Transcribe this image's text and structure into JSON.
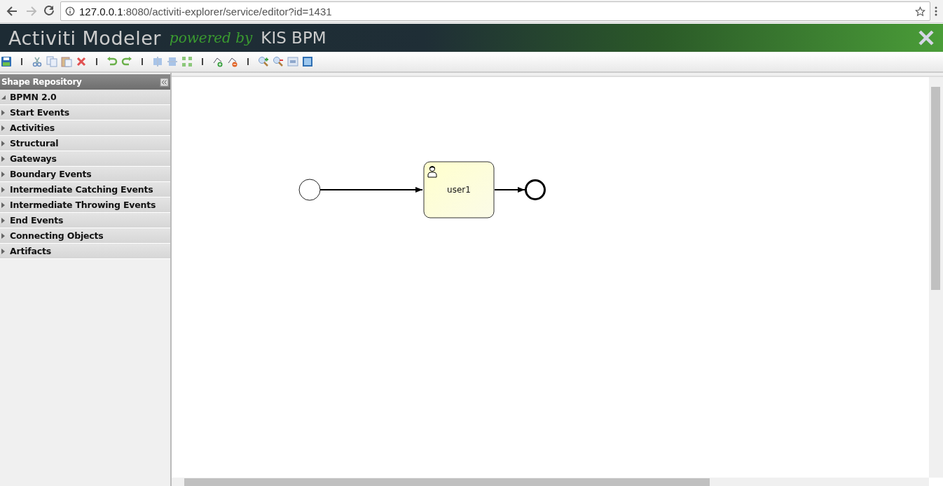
{
  "browser": {
    "url_host": "127.0.0.1",
    "url_rest": ":8080/activiti-explorer/service/editor?id=1431"
  },
  "header": {
    "title": "Activiti Modeler",
    "tagline": "powered by",
    "brand": "KIS BPM"
  },
  "sidebar": {
    "title": "Shape Repository",
    "items": [
      {
        "label": "BPMN 2.0",
        "expanded": true
      },
      {
        "label": "Start Events",
        "expanded": false
      },
      {
        "label": "Activities",
        "expanded": false
      },
      {
        "label": "Structural",
        "expanded": false
      },
      {
        "label": "Gateways",
        "expanded": false
      },
      {
        "label": "Boundary Events",
        "expanded": false
      },
      {
        "label": "Intermediate Catching Events",
        "expanded": false
      },
      {
        "label": "Intermediate Throwing Events",
        "expanded": false
      },
      {
        "label": "End Events",
        "expanded": false
      },
      {
        "label": "Connecting Objects",
        "expanded": false
      },
      {
        "label": "Artifacts",
        "expanded": false
      }
    ]
  },
  "canvas": {
    "nodes": [
      {
        "kind": "start"
      },
      {
        "kind": "task",
        "label": "user1"
      },
      {
        "kind": "end"
      }
    ]
  }
}
